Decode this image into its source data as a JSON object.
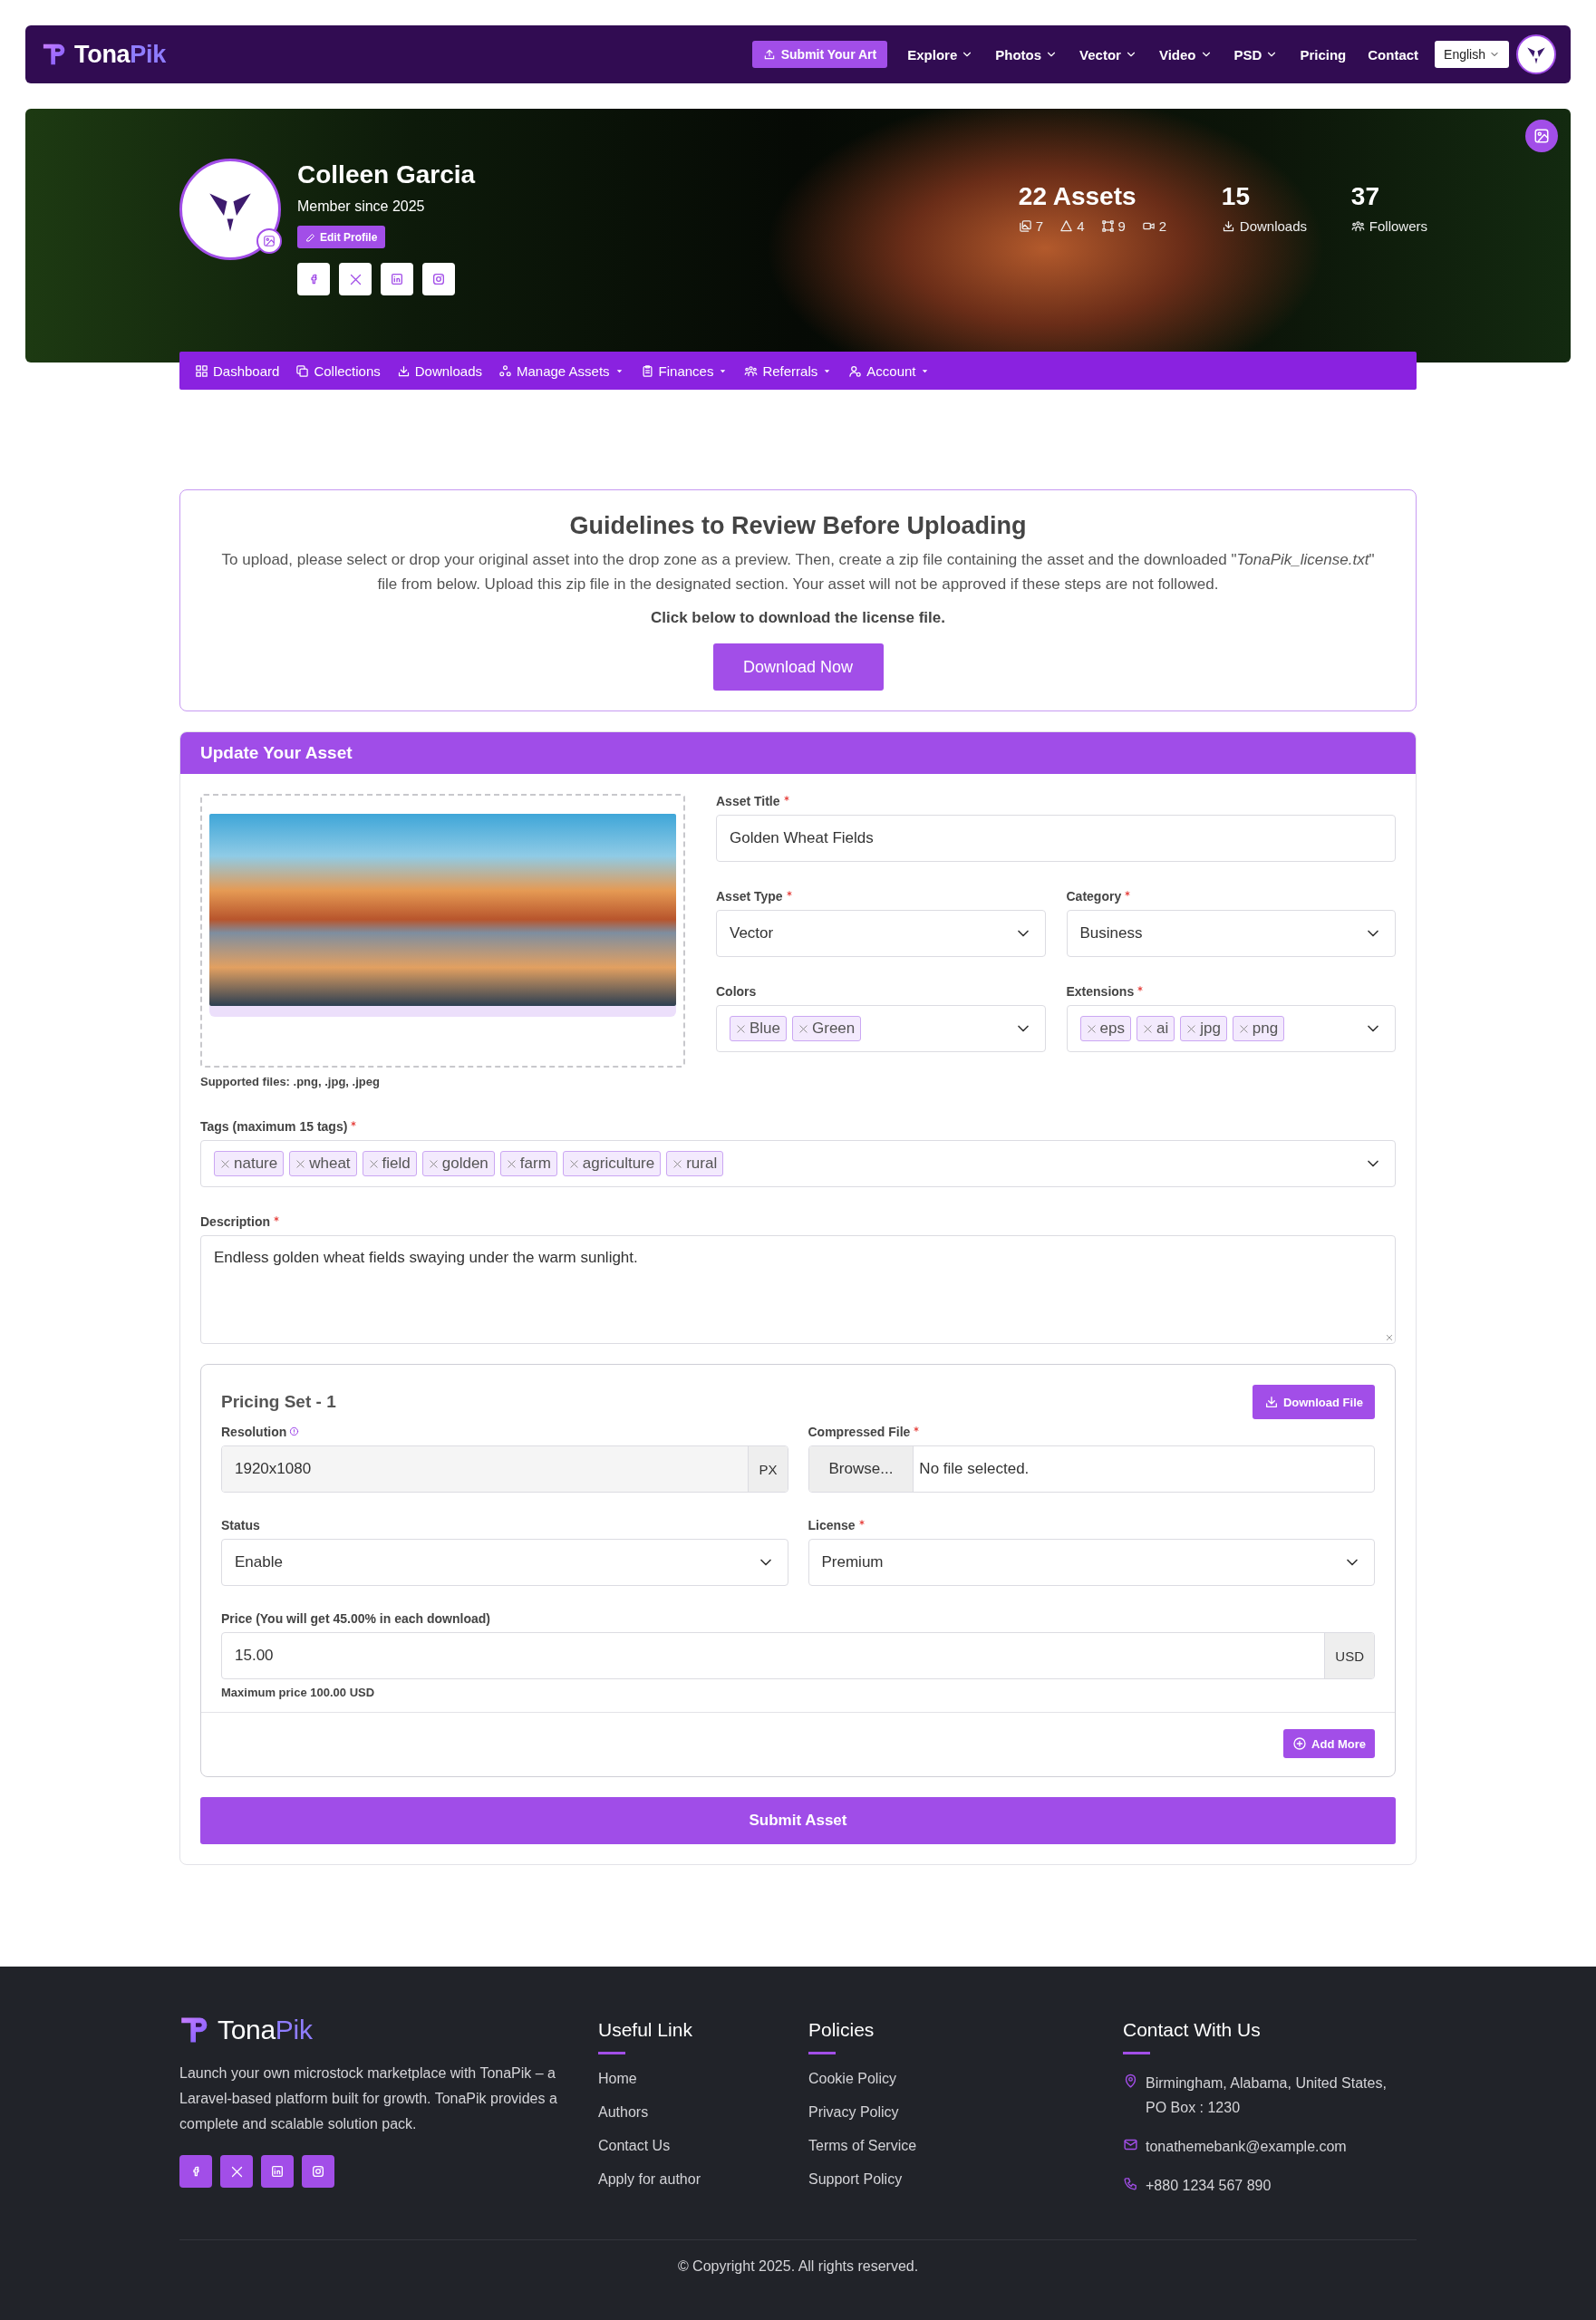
{
  "topbar": {
    "logo": {
      "first": "Tona",
      "second": "Pik"
    },
    "submit_button": "Submit Your Art",
    "menu": [
      {
        "label": "Explore",
        "dropdown": true
      },
      {
        "label": "Photos",
        "dropdown": true
      },
      {
        "label": "Vector",
        "dropdown": true
      },
      {
        "label": "Video",
        "dropdown": true
      },
      {
        "label": "PSD",
        "dropdown": true
      },
      {
        "label": "Pricing",
        "dropdown": false
      },
      {
        "label": "Contact",
        "dropdown": false
      }
    ],
    "language": "English"
  },
  "profile": {
    "name": "Colleen Garcia",
    "member_since": "Member since 2025",
    "edit_button": "Edit Profile",
    "assets": "22 Assets",
    "asset_counts": [
      "7",
      "4",
      "9",
      "2"
    ],
    "downloads": {
      "value": "15",
      "label": "Downloads"
    },
    "followers": {
      "value": "37",
      "label": "Followers"
    }
  },
  "subnav": [
    {
      "label": "Dashboard",
      "dropdown": false
    },
    {
      "label": "Collections",
      "dropdown": false
    },
    {
      "label": "Downloads",
      "dropdown": false
    },
    {
      "label": "Manage Assets",
      "dropdown": true
    },
    {
      "label": "Finances",
      "dropdown": true
    },
    {
      "label": "Referrals",
      "dropdown": true
    },
    {
      "label": "Account",
      "dropdown": true
    }
  ],
  "guidelines": {
    "title": "Guidelines to Review Before Uploading",
    "text": "To upload, please select or drop your original asset into the drop zone as a preview. Then, create a zip file containing the asset and the downloaded \"*TonaPik_license.txt*\" file from below. Upload this zip file in the designated section. Your asset will not be approved if these steps are not followed.",
    "note": "Click below to download the license file.",
    "button": "Download Now"
  },
  "form": {
    "header": "Update Your Asset",
    "supported_files": "Supported files: **.png, .jpg, .jpeg**",
    "asset_title": {
      "label": "Asset Title",
      "required": true,
      "value": "Golden Wheat Fields"
    },
    "asset_type": {
      "label": "Asset Type",
      "required": true,
      "value": "Vector"
    },
    "category": {
      "label": "Category",
      "required": true,
      "value": "Business"
    },
    "colors": {
      "label": "Colors",
      "required": false,
      "chips": [
        "Blue",
        "Green"
      ]
    },
    "extensions": {
      "label": "Extensions",
      "required": true,
      "chips": [
        "eps",
        "ai",
        "jpg",
        "png"
      ]
    },
    "tags": {
      "label": "Tags (maximum **15** tags)",
      "required": true,
      "chips": [
        "nature",
        "wheat",
        "field",
        "golden",
        "farm",
        "agriculture",
        "rural"
      ]
    },
    "description": {
      "label": "Description",
      "required": true,
      "value": "Endless golden wheat fields swaying under the warm sunlight."
    },
    "pricing": {
      "title": "Pricing Set - 1",
      "download_button": "Download File",
      "resolution": {
        "label": "Resolution",
        "required": false,
        "value": "1920x1080",
        "unit": "PX"
      },
      "compressed_file": {
        "label": "Compressed File",
        "required": true,
        "button": "Browse...",
        "file": "No file selected."
      },
      "status": {
        "label": "Status",
        "required": false,
        "value": "Enable"
      },
      "license": {
        "label": "License",
        "required": true,
        "value": "Premium"
      },
      "price": {
        "label": "Price (You will get **45.00%** in each download)",
        "required": false,
        "value": "15.00",
        "unit": "USD"
      },
      "max_price": "Maximum price **100.00 USD**",
      "add_button": "Add More"
    },
    "submit_button": "Submit Asset"
  },
  "footer": {
    "logo": {
      "first": "Tona",
      "second": "Pik"
    },
    "about": "Launch your own microstock marketplace with TonaPik – a Laravel-based platform built for growth. TonaPik provides a complete and scalable solution pack.",
    "columns": [
      {
        "title": "Useful Link",
        "links": [
          "Home",
          "Authors",
          "Contact Us",
          "Apply for author"
        ]
      },
      {
        "title": "Policies",
        "links": [
          "Cookie Policy",
          "Privacy Policy",
          "Terms of Service",
          "Support Policy"
        ]
      }
    ],
    "contact": {
      "title": "Contact With Us",
      "items": [
        "Birmingham, Alabama, United States, PO Box : 1230",
        "tonathemebank@example.com",
        "+880 1234 567 890"
      ]
    },
    "copyright": "© Copyright 2025. All rights reserved."
  }
}
